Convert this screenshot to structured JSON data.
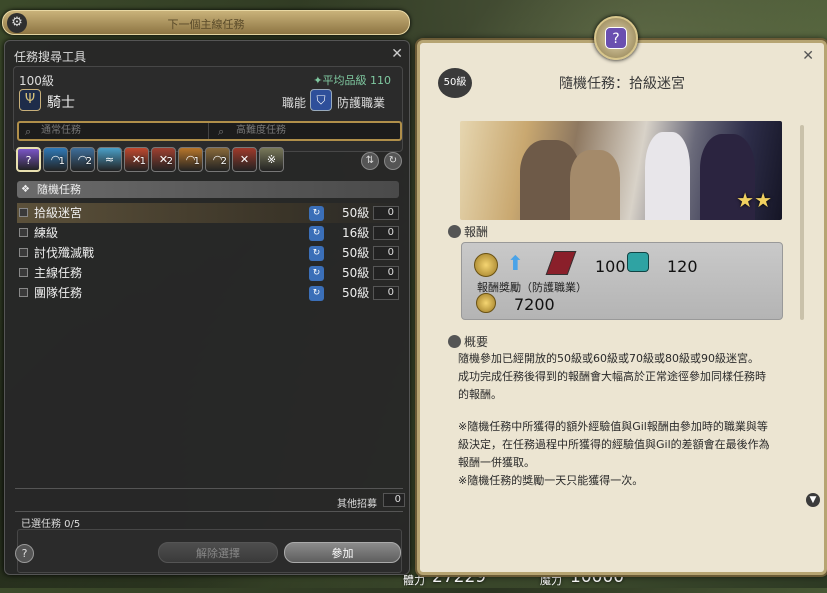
{
  "topbar": {
    "text": "下一個主線任務",
    "settings_icon": "gear-icon"
  },
  "finder": {
    "title": "任務搜尋工具",
    "level": "100級",
    "avg_ilvl_label": "平均品級",
    "avg_ilvl": "110",
    "job_name": "騎士",
    "role_label": "職能",
    "role_name": "防護職業",
    "search_placeholder_1": "通常任務",
    "search_placeholder_2": "高難度任務",
    "categories": [
      {
        "icon": "roulette-icon",
        "count": "",
        "color": "#7b55c8",
        "glyph": "?"
      },
      {
        "icon": "dungeon-icon",
        "count": "1",
        "color": "#2f7ab8",
        "glyph": "◠"
      },
      {
        "icon": "guildhest-icon",
        "count": "2",
        "color": "#3f6f9c",
        "glyph": "◠"
      },
      {
        "icon": "trial-icon",
        "count": "",
        "color": "#4aa0c8",
        "glyph": "≈"
      },
      {
        "icon": "raid-icon",
        "count": "1",
        "color": "#c0482e",
        "glyph": "✕"
      },
      {
        "icon": "pvp-icon",
        "count": "2",
        "color": "#a04030",
        "glyph": "✕"
      },
      {
        "icon": "gold-saucer-icon",
        "count": "1",
        "color": "#b8762a",
        "glyph": "◠"
      },
      {
        "icon": "deep-dungeon-icon",
        "count": "2",
        "color": "#8a6a3a",
        "glyph": "◠"
      },
      {
        "icon": "variant-icon",
        "count": "",
        "color": "#a03a2a",
        "glyph": "✕"
      },
      {
        "icon": "explorer-icon",
        "count": "",
        "color": "#7a7a5a",
        "glyph": "※"
      }
    ],
    "section_title": "隨機任務",
    "rows": [
      {
        "name": "拾級迷宮",
        "level": "50級",
        "count": "0"
      },
      {
        "name": "練級",
        "level": "16級",
        "count": "0"
      },
      {
        "name": "討伐殲滅戰",
        "level": "50級",
        "count": "0"
      },
      {
        "name": "主線任務",
        "level": "50級",
        "count": "0"
      },
      {
        "name": "團隊任務",
        "level": "50級",
        "count": "0"
      }
    ],
    "other_label": "其他招募",
    "other_count": "0",
    "selected_label": "已選任務 0/5",
    "help": "?",
    "clear_button": "解除選擇",
    "join_button": "參加"
  },
  "stats": {
    "hp_label": "體力",
    "hp": "27229",
    "mp_label": "魔力",
    "mp": "10000",
    "hp_color": "#6fd36a",
    "mp_color": "#d85aa0"
  },
  "detail": {
    "level_badge": "50級",
    "title": "隨機任務：拾級迷宮",
    "reward_header": "報酬",
    "reward_exp": "100",
    "reward_tomestone": "120",
    "reward_bonus_label": "報酬獎勵（防護職業）",
    "reward_gil": "7200",
    "overview_header": "概要",
    "overview_p1": "隨機參加已經開放的50級或60級或70級或80級或90級迷宮。\n成功完成任務後得到的報酬會大幅高於正常途徑參加同樣任務時\n的報酬。",
    "overview_p2": "※隨機任務中所獲得的額外經驗值與Gil報酬由參加時的職業與等\n級決定，在任務過程中所獲得的經驗值與Gil的差額會在最後作為\n報酬一併獲取。\n※隨機任務的獎勵一天只能獲得一次。"
  }
}
